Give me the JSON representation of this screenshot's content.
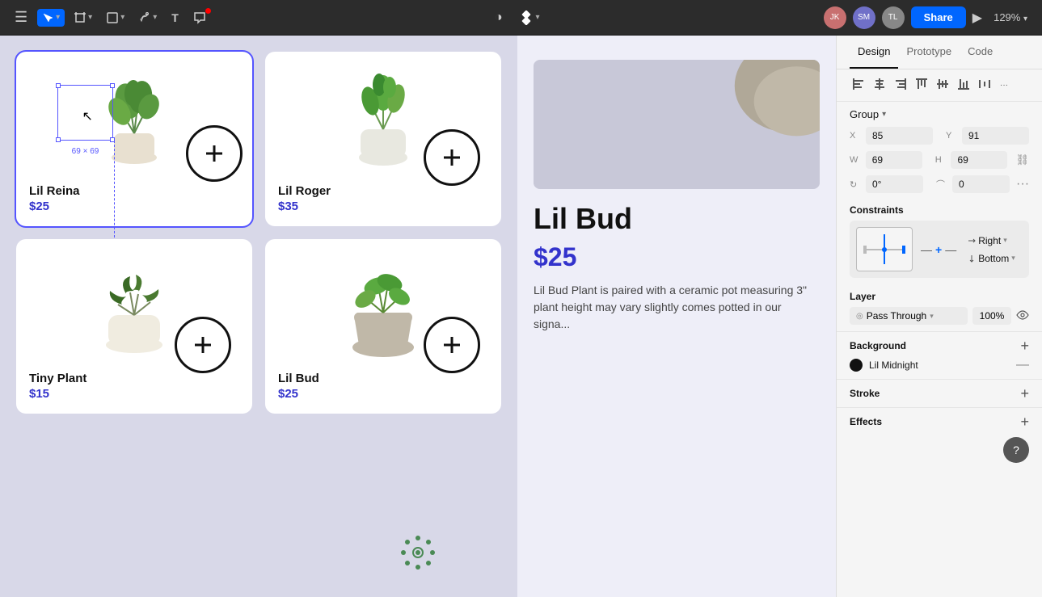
{
  "toolbar": {
    "menu_icon": "☰",
    "tools": [
      {
        "id": "select",
        "label": "▶",
        "active": true
      },
      {
        "id": "frame",
        "label": "⊞",
        "active": false
      },
      {
        "id": "shape",
        "label": "□",
        "active": false
      },
      {
        "id": "pen",
        "label": "✒",
        "active": false
      },
      {
        "id": "text",
        "label": "T",
        "active": false
      },
      {
        "id": "comment",
        "label": "💬",
        "active": false
      }
    ],
    "share_label": "Share",
    "zoom_label": "129%"
  },
  "panel": {
    "tabs": [
      "Design",
      "Prototype",
      "Code"
    ],
    "active_tab": "Design",
    "group_label": "Group",
    "x_label": "X",
    "x_value": "85",
    "y_label": "Y",
    "y_value": "91",
    "w_label": "W",
    "w_value": "69",
    "h_label": "H",
    "h_value": "69",
    "rotation_value": "0°",
    "corner_value": "0",
    "constraints_label": "Constraints",
    "constraint_h": "Right",
    "constraint_v": "Bottom",
    "layer_label": "Layer",
    "blend_mode": "Pass Through",
    "opacity_value": "100%",
    "background_label": "Background",
    "color_name": "Lil Midnight",
    "stroke_label": "Stroke",
    "effects_label": "Effects",
    "help_label": "?"
  },
  "canvas": {
    "selection_label": "69 × 69"
  },
  "products": [
    {
      "name": "Lil Reina",
      "price": "$25",
      "selected": true
    },
    {
      "name": "Lil Roger",
      "price": "$35",
      "selected": false
    },
    {
      "name": "Tiny Plant",
      "price": "$15",
      "selected": false
    },
    {
      "name": "Lil Bud",
      "price": "$25",
      "selected": false
    }
  ],
  "product_detail": {
    "title": "Lil Bud",
    "price": "$25",
    "description": "Lil Bud Plant is paired with a ceramic pot measuring 3\" plant height may vary slightly comes potted in our signa..."
  }
}
